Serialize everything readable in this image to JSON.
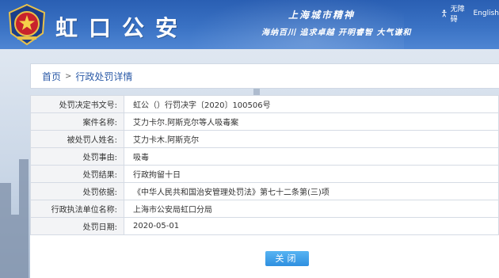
{
  "header": {
    "site_title": "虹口公安",
    "slogan_line1": "上海城市精神",
    "slogan_line2": "海纳百川  追求卓越  开明睿智  大气谦和",
    "accessibility_label": "无障碍",
    "english_label": "English",
    "icons": {
      "emblem": "police-emblem-icon",
      "accessibility": "accessibility-icon"
    }
  },
  "breadcrumb": {
    "home": "首页",
    "separator": ">",
    "current": "行政处罚详情"
  },
  "details": {
    "rows": [
      {
        "label": "处罚决定书文号:",
        "value": "虹公（）行罚决字〔2020〕100506号"
      },
      {
        "label": "案件名称:",
        "value": "艾力卡尔.阿斯克尔等人吸毒案"
      },
      {
        "label": "被处罚人姓名:",
        "value": "艾力卡木.阿斯克尔"
      },
      {
        "label": "处罚事由:",
        "value": "吸毒"
      },
      {
        "label": "处罚结果:",
        "value": "行政拘留十日"
      },
      {
        "label": "处罚依据:",
        "value": "《中华人民共和国治安管理处罚法》第七十二条第(三)项"
      },
      {
        "label": "行政执法单位名称:",
        "value": "上海市公安局虹口分局"
      },
      {
        "label": "处罚日期:",
        "value": "2020-05-01"
      }
    ]
  },
  "close_button": {
    "label": "关闭"
  },
  "colors": {
    "header_blue": "#2a5fb3",
    "link_blue": "#2b5aa7",
    "button_blue": "#2f8fe0"
  }
}
